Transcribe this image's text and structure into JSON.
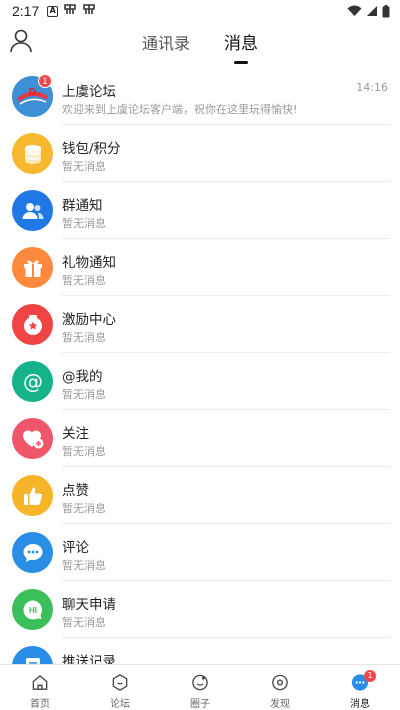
{
  "status_bar": {
    "time": "2:17",
    "icons": [
      "a-icon",
      "app-icon",
      "app-icon"
    ]
  },
  "header": {
    "tabs": [
      {
        "label": "通讯录",
        "active": false
      },
      {
        "label": "消息",
        "active": true
      }
    ]
  },
  "messages": [
    {
      "title": "上虞论坛",
      "subtitle": "欢迎来到上虞论坛客户端，祝你在这里玩得愉快!",
      "time": "14:16",
      "badge": "1",
      "icon": "forum-logo",
      "color": "#3d8fd6"
    },
    {
      "title": "钱包/积分",
      "subtitle": "暂无消息",
      "icon": "wallet-icon",
      "color": "#f5b82e"
    },
    {
      "title": "群通知",
      "subtitle": "暂无消息",
      "icon": "group-icon",
      "color": "#1f78e6"
    },
    {
      "title": "礼物通知",
      "subtitle": "暂无消息",
      "icon": "gift-icon",
      "color": "#ff8a3d"
    },
    {
      "title": "激励中心",
      "subtitle": "暂无消息",
      "icon": "incentive-icon",
      "color": "#ef4444"
    },
    {
      "title": "@我的",
      "subtitle": "暂无消息",
      "icon": "at-icon",
      "color": "#16b38a"
    },
    {
      "title": "关注",
      "subtitle": "暂无消息",
      "icon": "heart-plus-icon",
      "color": "#f0566a"
    },
    {
      "title": "点赞",
      "subtitle": "暂无消息",
      "icon": "thumbs-up-icon",
      "color": "#f6b428"
    },
    {
      "title": "评论",
      "subtitle": "暂无消息",
      "icon": "comment-icon",
      "color": "#2b8ee6"
    },
    {
      "title": "聊天申请",
      "subtitle": "暂无消息",
      "icon": "chat-hi-icon",
      "color": "#3bbf5a"
    },
    {
      "title": "推送记录",
      "subtitle": "",
      "icon": "push-record-icon",
      "color": "#2b8ee6"
    }
  ],
  "bottom_nav": [
    {
      "label": "首页",
      "icon": "home-icon"
    },
    {
      "label": "论坛",
      "icon": "forum-icon"
    },
    {
      "label": "圈子",
      "icon": "circle-icon"
    },
    {
      "label": "发现",
      "icon": "discover-icon"
    },
    {
      "label": "消息",
      "icon": "message-icon",
      "active": true,
      "badge": "1"
    }
  ]
}
